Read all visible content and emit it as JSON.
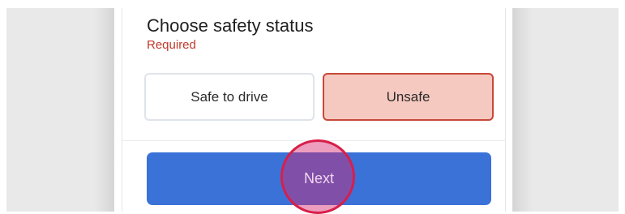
{
  "form": {
    "title": "Choose safety status",
    "required_label": "Required"
  },
  "options": {
    "safe_label": "Safe to drive",
    "unsafe_label": "Unsafe",
    "selected": "Unsafe"
  },
  "actions": {
    "next_label": "Next"
  },
  "colors": {
    "primary_button": "#3a72d8",
    "required_text": "#c0392b",
    "selected_fill": "#f6c9c0",
    "selected_border": "#c8483a",
    "tap_marker": "#d81e4a"
  }
}
